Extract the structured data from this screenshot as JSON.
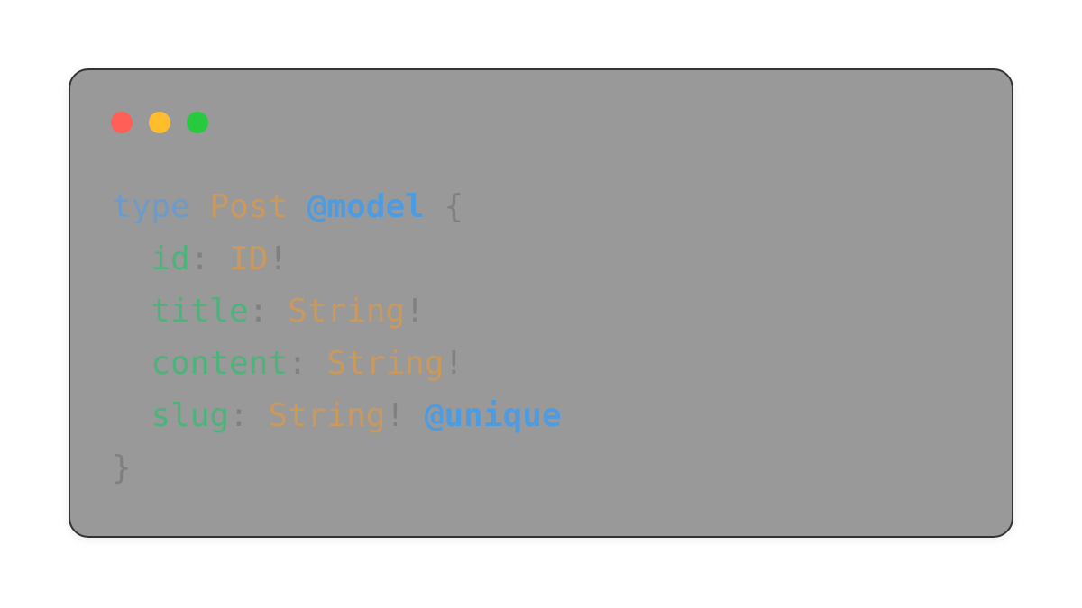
{
  "window": {
    "controls": [
      {
        "name": "close",
        "color": "#ff5f56"
      },
      {
        "name": "minimize",
        "color": "#ffbd2e"
      },
      {
        "name": "maximize",
        "color": "#27c93f"
      }
    ]
  },
  "colors": {
    "keyword": "#6b9bc8",
    "type": "#c9995e",
    "directive": "#4f9be0",
    "field": "#4cb37a",
    "punctuation": "#808080"
  },
  "code": {
    "language": "graphql",
    "lines": [
      [
        {
          "text": "type",
          "role": "keyword"
        },
        {
          "text": " ",
          "role": "punctuation"
        },
        {
          "text": "Post",
          "role": "type"
        },
        {
          "text": " ",
          "role": "punctuation"
        },
        {
          "text": "@model",
          "role": "directive"
        },
        {
          "text": " {",
          "role": "punctuation"
        }
      ],
      [
        {
          "text": "  ",
          "role": "punctuation"
        },
        {
          "text": "id",
          "role": "field"
        },
        {
          "text": ": ",
          "role": "punctuation"
        },
        {
          "text": "ID",
          "role": "type"
        },
        {
          "text": "!",
          "role": "punctuation"
        }
      ],
      [
        {
          "text": "  ",
          "role": "punctuation"
        },
        {
          "text": "title",
          "role": "field"
        },
        {
          "text": ": ",
          "role": "punctuation"
        },
        {
          "text": "String",
          "role": "type"
        },
        {
          "text": "!",
          "role": "punctuation"
        }
      ],
      [
        {
          "text": "  ",
          "role": "punctuation"
        },
        {
          "text": "content",
          "role": "field"
        },
        {
          "text": ": ",
          "role": "punctuation"
        },
        {
          "text": "String",
          "role": "type"
        },
        {
          "text": "!",
          "role": "punctuation"
        }
      ],
      [
        {
          "text": "  ",
          "role": "punctuation"
        },
        {
          "text": "slug",
          "role": "field"
        },
        {
          "text": ": ",
          "role": "punctuation"
        },
        {
          "text": "String",
          "role": "type"
        },
        {
          "text": "! ",
          "role": "punctuation"
        },
        {
          "text": "@unique",
          "role": "directive"
        }
      ],
      [
        {
          "text": "}",
          "role": "punctuation"
        }
      ]
    ]
  }
}
